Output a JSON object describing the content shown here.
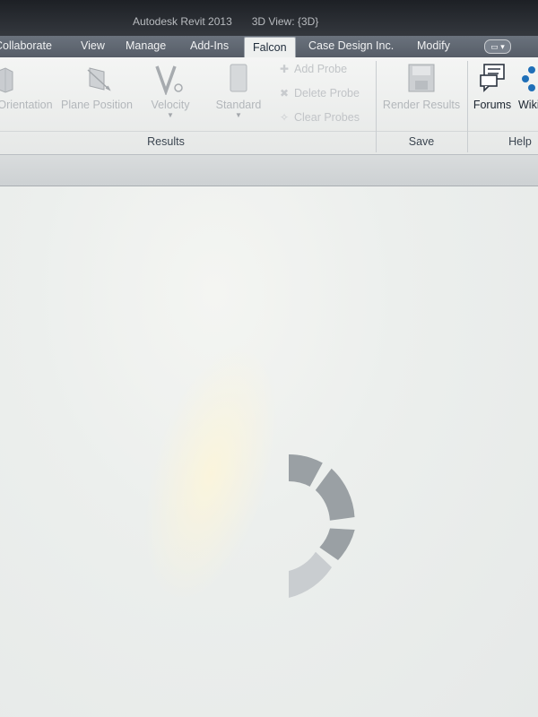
{
  "window": {
    "app_title": "Autodesk Revit 2013",
    "view_title": "3D View: {3D}"
  },
  "menu": {
    "tabs": [
      {
        "label": "Collaborate"
      },
      {
        "label": "View"
      },
      {
        "label": "Manage"
      },
      {
        "label": "Add-Ins"
      },
      {
        "label": "Falcon",
        "active": true
      },
      {
        "label": "Case Design Inc."
      },
      {
        "label": "Modify"
      }
    ]
  },
  "ribbon": {
    "results_panel": {
      "label": "Results",
      "buttons": {
        "orientation": "Orientation",
        "plane_position": "Plane Position",
        "velocity": "Velocity",
        "standard": "Standard",
        "add_probe": "Add Probe",
        "delete_probe": "Delete Probe",
        "clear_probes": "Clear Probes"
      }
    },
    "save_panel": {
      "label": "Save",
      "buttons": {
        "render_results": "Render Results"
      }
    },
    "help_panel": {
      "label": "Help",
      "buttons": {
        "forums": "Forums",
        "wiki": "Wiki"
      }
    }
  },
  "colors": {
    "accent_dark": "#1d2025",
    "spinner": "#9aa0a4",
    "spinner_faded": "#c9cdd0",
    "disabled_text": "#b3b7bb"
  },
  "icons": [
    "orientation-icon",
    "plane-position-icon",
    "velocity-icon",
    "standard-icon",
    "add-probe-icon",
    "delete-probe-icon",
    "clear-probes-icon",
    "render-results-icon",
    "forums-icon",
    "wiki-icon",
    "loading-spinner"
  ]
}
